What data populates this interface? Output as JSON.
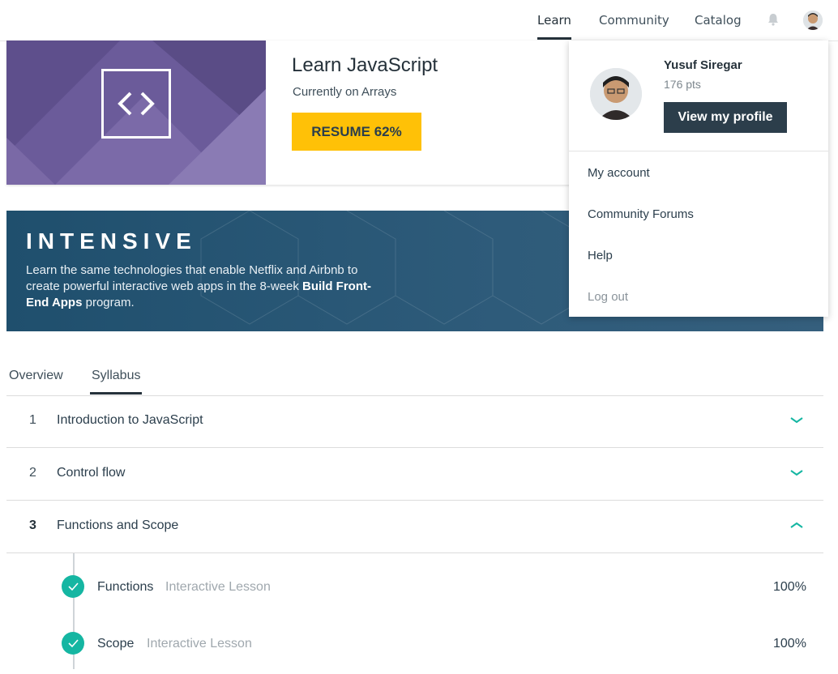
{
  "nav": {
    "links": [
      "Learn",
      "Community",
      "Catalog"
    ],
    "active": "Learn"
  },
  "course": {
    "title": "Learn JavaScript",
    "subtitle": "Currently on Arrays",
    "resume_label": "RESUME 62%",
    "progress_percent": 62
  },
  "banner": {
    "title": "INTENSIVE",
    "text_plain": "Learn the same technologies that enable Netflix and Airbnb to create powerful interactive web apps in the 8-week ",
    "text_bold": "Build Front-End Apps",
    "text_end": " program."
  },
  "tabs": [
    "Overview",
    "Syllabus"
  ],
  "active_tab": "Syllabus",
  "modules": [
    {
      "num": "1",
      "title": "Introduction to JavaScript",
      "expanded": false
    },
    {
      "num": "2",
      "title": "Control flow",
      "expanded": false
    },
    {
      "num": "3",
      "title": "Functions and Scope",
      "expanded": true
    }
  ],
  "lessons": [
    {
      "title": "Functions",
      "type": "Interactive Lesson",
      "percent": "100%"
    },
    {
      "title": "Scope",
      "type": "Interactive Lesson",
      "percent": "100%"
    }
  ],
  "dropdown": {
    "name": "Yusuf Siregar",
    "points": "176 pts",
    "profile_button": "View my profile",
    "items": [
      "My account",
      "Community Forums",
      "Help",
      "Log out"
    ]
  },
  "colors": {
    "accent_yellow": "#ffc107",
    "teal": "#15b6a2",
    "dark_button": "#2c3e4b",
    "hero_purple": "#6b5b9a",
    "banner_blue": "#1f4f6d"
  },
  "icons": {
    "bell": "bell-icon",
    "code": "code-brackets-icon",
    "check": "check-icon",
    "chevron_down": "chevron-down-icon",
    "chevron_up": "chevron-up-icon"
  }
}
